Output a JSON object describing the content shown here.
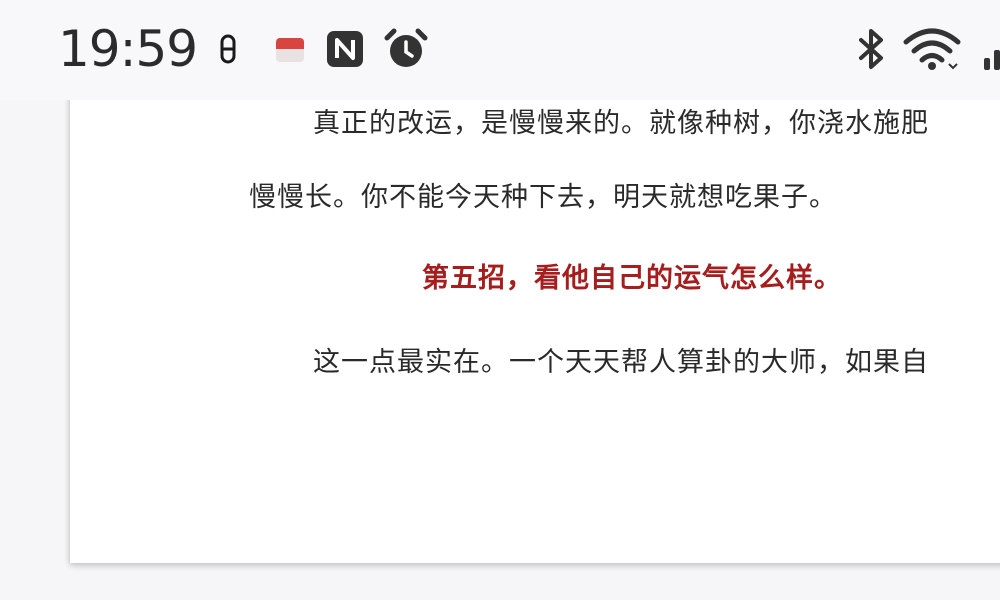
{
  "status_bar": {
    "time": "19:59",
    "icons": [
      "vpn-key-icon",
      "app-notification-icon",
      "nfc-icon",
      "alarm-icon",
      "bluetooth-icon",
      "wifi-icon",
      "signal-icon"
    ]
  },
  "document": {
    "paragraphs": [
      "真正的改运，是慢慢来的。就像种树，你浇水施肥",
      "慢慢长。你不能今天种下去，明天就想吃果子。"
    ],
    "heading": "第五招，看他自己的运气怎么样。",
    "paragraph_after": "这一点最实在。一个天天帮人算卦的大师，如果自"
  },
  "colors": {
    "heading": "#a51d1d",
    "body_text": "#2a2a2a",
    "status_bar_bg": "#f8f8fa"
  }
}
